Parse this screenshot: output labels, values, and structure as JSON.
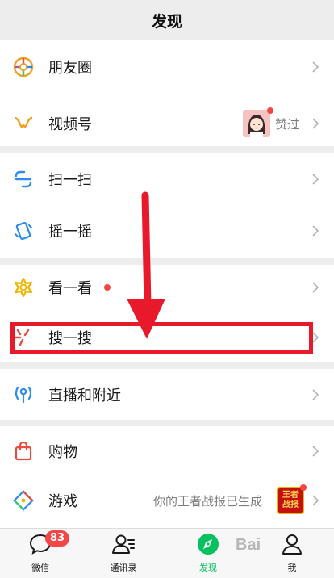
{
  "header": {
    "title": "发现"
  },
  "items": [
    {
      "label": "朋友圈",
      "icon": "moments-icon"
    },
    {
      "label": "视频号",
      "icon": "channels-icon",
      "right_text": "赞过"
    },
    {
      "label": "扫一扫",
      "icon": "scan-icon"
    },
    {
      "label": "摇一摇",
      "icon": "shake-icon"
    },
    {
      "label": "看一看",
      "icon": "top-stories-icon"
    },
    {
      "label": "搜一搜",
      "icon": "search-icon"
    },
    {
      "label": "直播和附近",
      "icon": "live-nearby-icon"
    },
    {
      "label": "购物",
      "icon": "shopping-icon"
    },
    {
      "label": "游戏",
      "icon": "games-icon",
      "right_text": "你的王者战报已生成"
    }
  ],
  "game_thumb": {
    "line1": "王者",
    "line2": "战报"
  },
  "tabs": [
    {
      "label": "微信",
      "badge": "83"
    },
    {
      "label": "通讯录"
    },
    {
      "label": "发现",
      "active": true
    },
    {
      "label": "我"
    }
  ],
  "watermark": "Bai",
  "colors": {
    "accent": "#07c160",
    "annotation_red": "#e8192b",
    "badge_red": "#f54646",
    "background": "#ededed"
  }
}
